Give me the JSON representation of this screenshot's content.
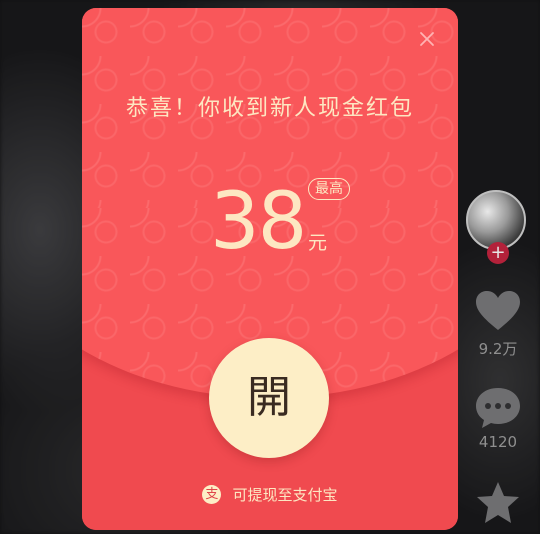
{
  "colors": {
    "packet_red": "#f9575a",
    "packet_red_dark": "#f04a4f",
    "gold_text": "#fde7c2",
    "button_cream": "#fdeec6",
    "button_text": "#3a2b21"
  },
  "rail": {
    "avatar_icon": "avatar",
    "follow_symbol": "+",
    "like_count": "9.2万",
    "comment_count": "4120"
  },
  "modal": {
    "close_icon": "close-icon",
    "headline": "恭喜！你收到新人现金红包",
    "amount": "38",
    "unit": "元",
    "max_badge": "最高",
    "open_button": "開",
    "footer_icon": "支",
    "footer_text": "可提现至支付宝"
  }
}
